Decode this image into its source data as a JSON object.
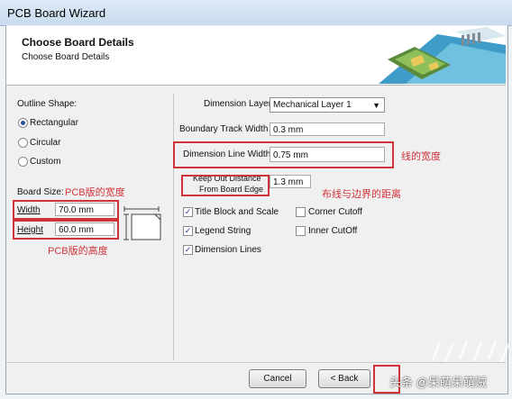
{
  "window": {
    "title": "PCB Board Wizard"
  },
  "header": {
    "title": "Choose Board Details",
    "subtitle": "Choose Board Details"
  },
  "outline": {
    "label": "Outline Shape:",
    "options": [
      {
        "label": "Rectangular",
        "selected": true
      },
      {
        "label": "Circular",
        "selected": false
      },
      {
        "label": "Custom",
        "selected": false
      }
    ]
  },
  "board_size": {
    "label": "Board Size:",
    "width_label": "Width",
    "width_value": "70.0 mm",
    "height_label": "Height",
    "height_value": "60.0 mm"
  },
  "right": {
    "dimension_layer_label": "Dimension Layer",
    "dimension_layer_value": "Mechanical Layer 1",
    "boundary_track_label": "Boundary Track Width",
    "boundary_track_value": "0.3 mm",
    "dimension_line_label": "Dimension Line Width",
    "dimension_line_value": "0.75 mm",
    "keepout_label_1": "Keep Out Distance",
    "keepout_label_2": "From Board Edge",
    "keepout_value": "1.3 mm"
  },
  "checkboxes": {
    "title_block": {
      "label": "Title Block and Scale",
      "checked": true
    },
    "legend": {
      "label": "Legend String",
      "checked": true
    },
    "dimension_lines": {
      "label": "Dimension Lines",
      "checked": true
    },
    "corner_cutoff": {
      "label": "Corner Cutoff",
      "checked": false
    },
    "inner_cutoff": {
      "label": "Inner CutOff",
      "checked": false
    }
  },
  "annotations": {
    "pcb_width": "PCB版的宽度",
    "pcb_height": "PCB版的高度",
    "line_width": "线的宽度",
    "edge_distance": "布线与边界的距离"
  },
  "buttons": {
    "cancel": "Cancel",
    "back": "< Back"
  },
  "watermark": "头条 @呆萌呆萌贼",
  "colors": {
    "annotation": "#d0343a",
    "header_bg": "#ffffff",
    "dialog_bg": "#f0f0f0"
  }
}
